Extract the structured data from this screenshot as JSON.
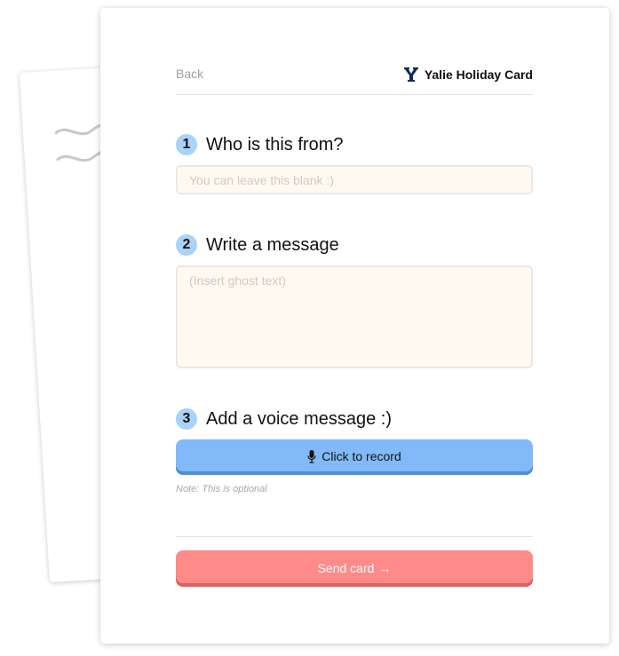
{
  "header": {
    "back_label": "Back",
    "brand_name": "Yalie Holiday Card",
    "brand_icon": "yale-y-logo"
  },
  "steps": [
    {
      "number": "1",
      "title": "Who is this from?"
    },
    {
      "number": "2",
      "title": "Write a message"
    },
    {
      "number": "3",
      "title": "Add a voice message :)"
    }
  ],
  "from_field": {
    "value": "",
    "placeholder": "You can leave this blank :)"
  },
  "message_field": {
    "value": "",
    "placeholder": "(Insert ghost text)"
  },
  "record": {
    "label": "Click to record",
    "icon": "microphone-icon",
    "note": "Note: This is optional"
  },
  "send": {
    "label": "Send card",
    "arrow": "→"
  },
  "colors": {
    "step_badge": "#a9d3f7",
    "record_button": "#82baf9",
    "send_button": "#ff8a8a",
    "field_bg": "#fff9f2",
    "brand_navy": "#0f2a5c"
  }
}
